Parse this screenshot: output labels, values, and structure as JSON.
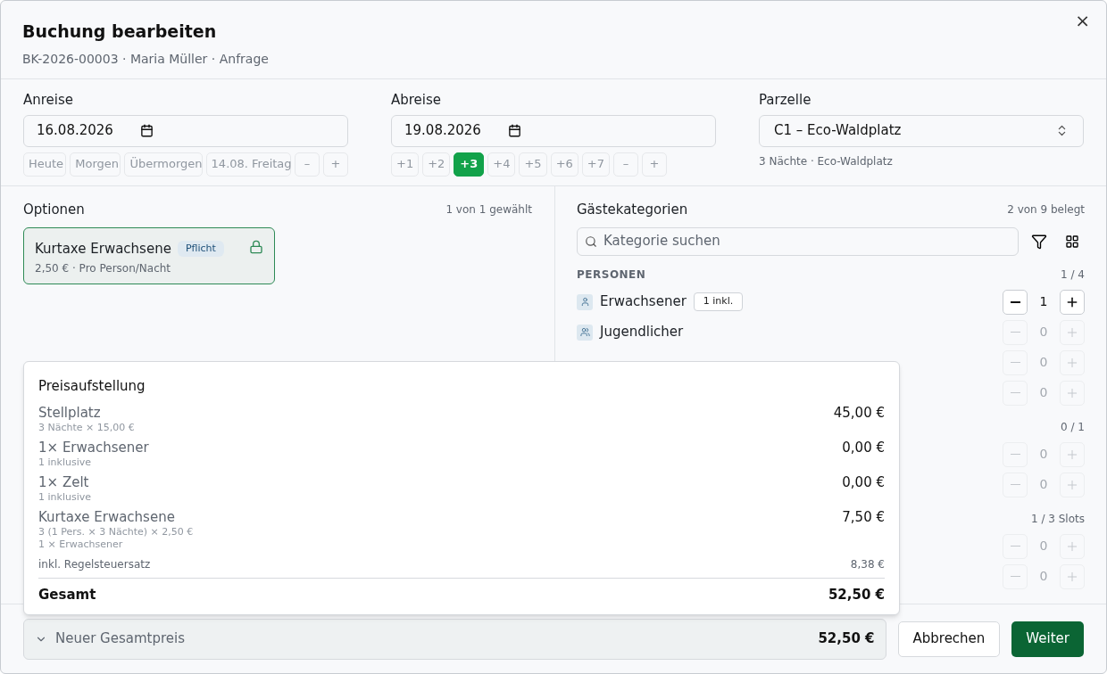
{
  "dialog": {
    "title": "Buchung bearbeiten",
    "subtitle": "BK-2026-00003 · Maria Müller · Anfrage",
    "close": "×"
  },
  "arrival": {
    "label": "Anreise",
    "value": "16.08.2026",
    "quick": [
      {
        "label": "Heute",
        "selected": false
      },
      {
        "label": "Morgen",
        "selected": false
      },
      {
        "label": "Übermorgen",
        "selected": false
      },
      {
        "label": "14.08. Freitag",
        "selected": false
      },
      {
        "label": "–",
        "selected": false
      },
      {
        "label": "+",
        "selected": false
      }
    ]
  },
  "departure": {
    "label": "Abreise",
    "value": "19.08.2026",
    "quick": [
      {
        "label": "+1",
        "selected": false
      },
      {
        "label": "+2",
        "selected": false
      },
      {
        "label": "+3",
        "selected": true
      },
      {
        "label": "+4",
        "selected": false
      },
      {
        "label": "+5",
        "selected": false
      },
      {
        "label": "+6",
        "selected": false
      },
      {
        "label": "+7",
        "selected": false
      },
      {
        "label": "–",
        "selected": false
      },
      {
        "label": "+",
        "selected": false
      }
    ]
  },
  "pitch": {
    "label": "Parzelle",
    "value": "C1 – Eco-Waldplatz",
    "hint": "3 Nächte · Eco-Waldplatz"
  },
  "options": {
    "title": "Optionen",
    "count": "1 von 1 gewählt",
    "items": [
      {
        "name": "Kurtaxe Erwachsene",
        "badge": "Pflicht",
        "detail": "2,50 € · Pro Person/Nacht",
        "selected": true,
        "locked": true
      }
    ]
  },
  "guests": {
    "title": "Gästekategorien",
    "count": "2 von 9 belegt",
    "search": {
      "placeholder": "Kategorie suchen"
    },
    "groups": [
      {
        "label": "PERSONEN",
        "count": "1 / 4",
        "rows": [
          {
            "name": "Erwachsener",
            "kind": "person",
            "badge": "1 inkl.",
            "value": "1",
            "disabled": false
          },
          {
            "name": "Jugendlicher",
            "kind": "group",
            "value": "0",
            "disabled": true
          },
          {
            "value": "0",
            "disabled": true
          },
          {
            "value": "0",
            "disabled": true
          }
        ]
      },
      {
        "count": "0 / 1",
        "rows": [
          {
            "value": "0",
            "disabled": true
          },
          {
            "value": "0",
            "disabled": true
          }
        ]
      },
      {
        "count": "1 / 3 Slots",
        "rows": [
          {
            "value": "0",
            "disabled": true
          },
          {
            "value": "0",
            "disabled": true
          }
        ]
      }
    ]
  },
  "price_breakdown": {
    "title": "Preisaufstellung",
    "lines": [
      {
        "label": "Stellplatz",
        "details": [
          "3 Nächte × 15,00 €"
        ],
        "amount": "45,00 €"
      },
      {
        "label": "1× Erwachsener",
        "details": [
          "1 inklusive"
        ],
        "amount": "0,00 €"
      },
      {
        "label": "1× Zelt",
        "details": [
          "1 inklusive"
        ],
        "amount": "0,00 €"
      },
      {
        "label": "Kurtaxe Erwachsene",
        "details": [
          "3 (1 Pers. × 3 Nächte) × 2,50 €",
          "1 × Erwachsener"
        ],
        "amount": "7,50 €"
      }
    ],
    "tax": {
      "label": "inkl. Regelsteuersatz",
      "amount": "8,38 €"
    },
    "total": {
      "label": "Gesamt",
      "amount": "52,50 €"
    }
  },
  "footer": {
    "summary": {
      "label": "Neuer Gesamtpreis",
      "amount": "52,50 €"
    },
    "buttons": [
      {
        "label": "Abbrechen",
        "kind": "secondary"
      },
      {
        "label": "Weiter",
        "kind": "primary"
      }
    ]
  }
}
